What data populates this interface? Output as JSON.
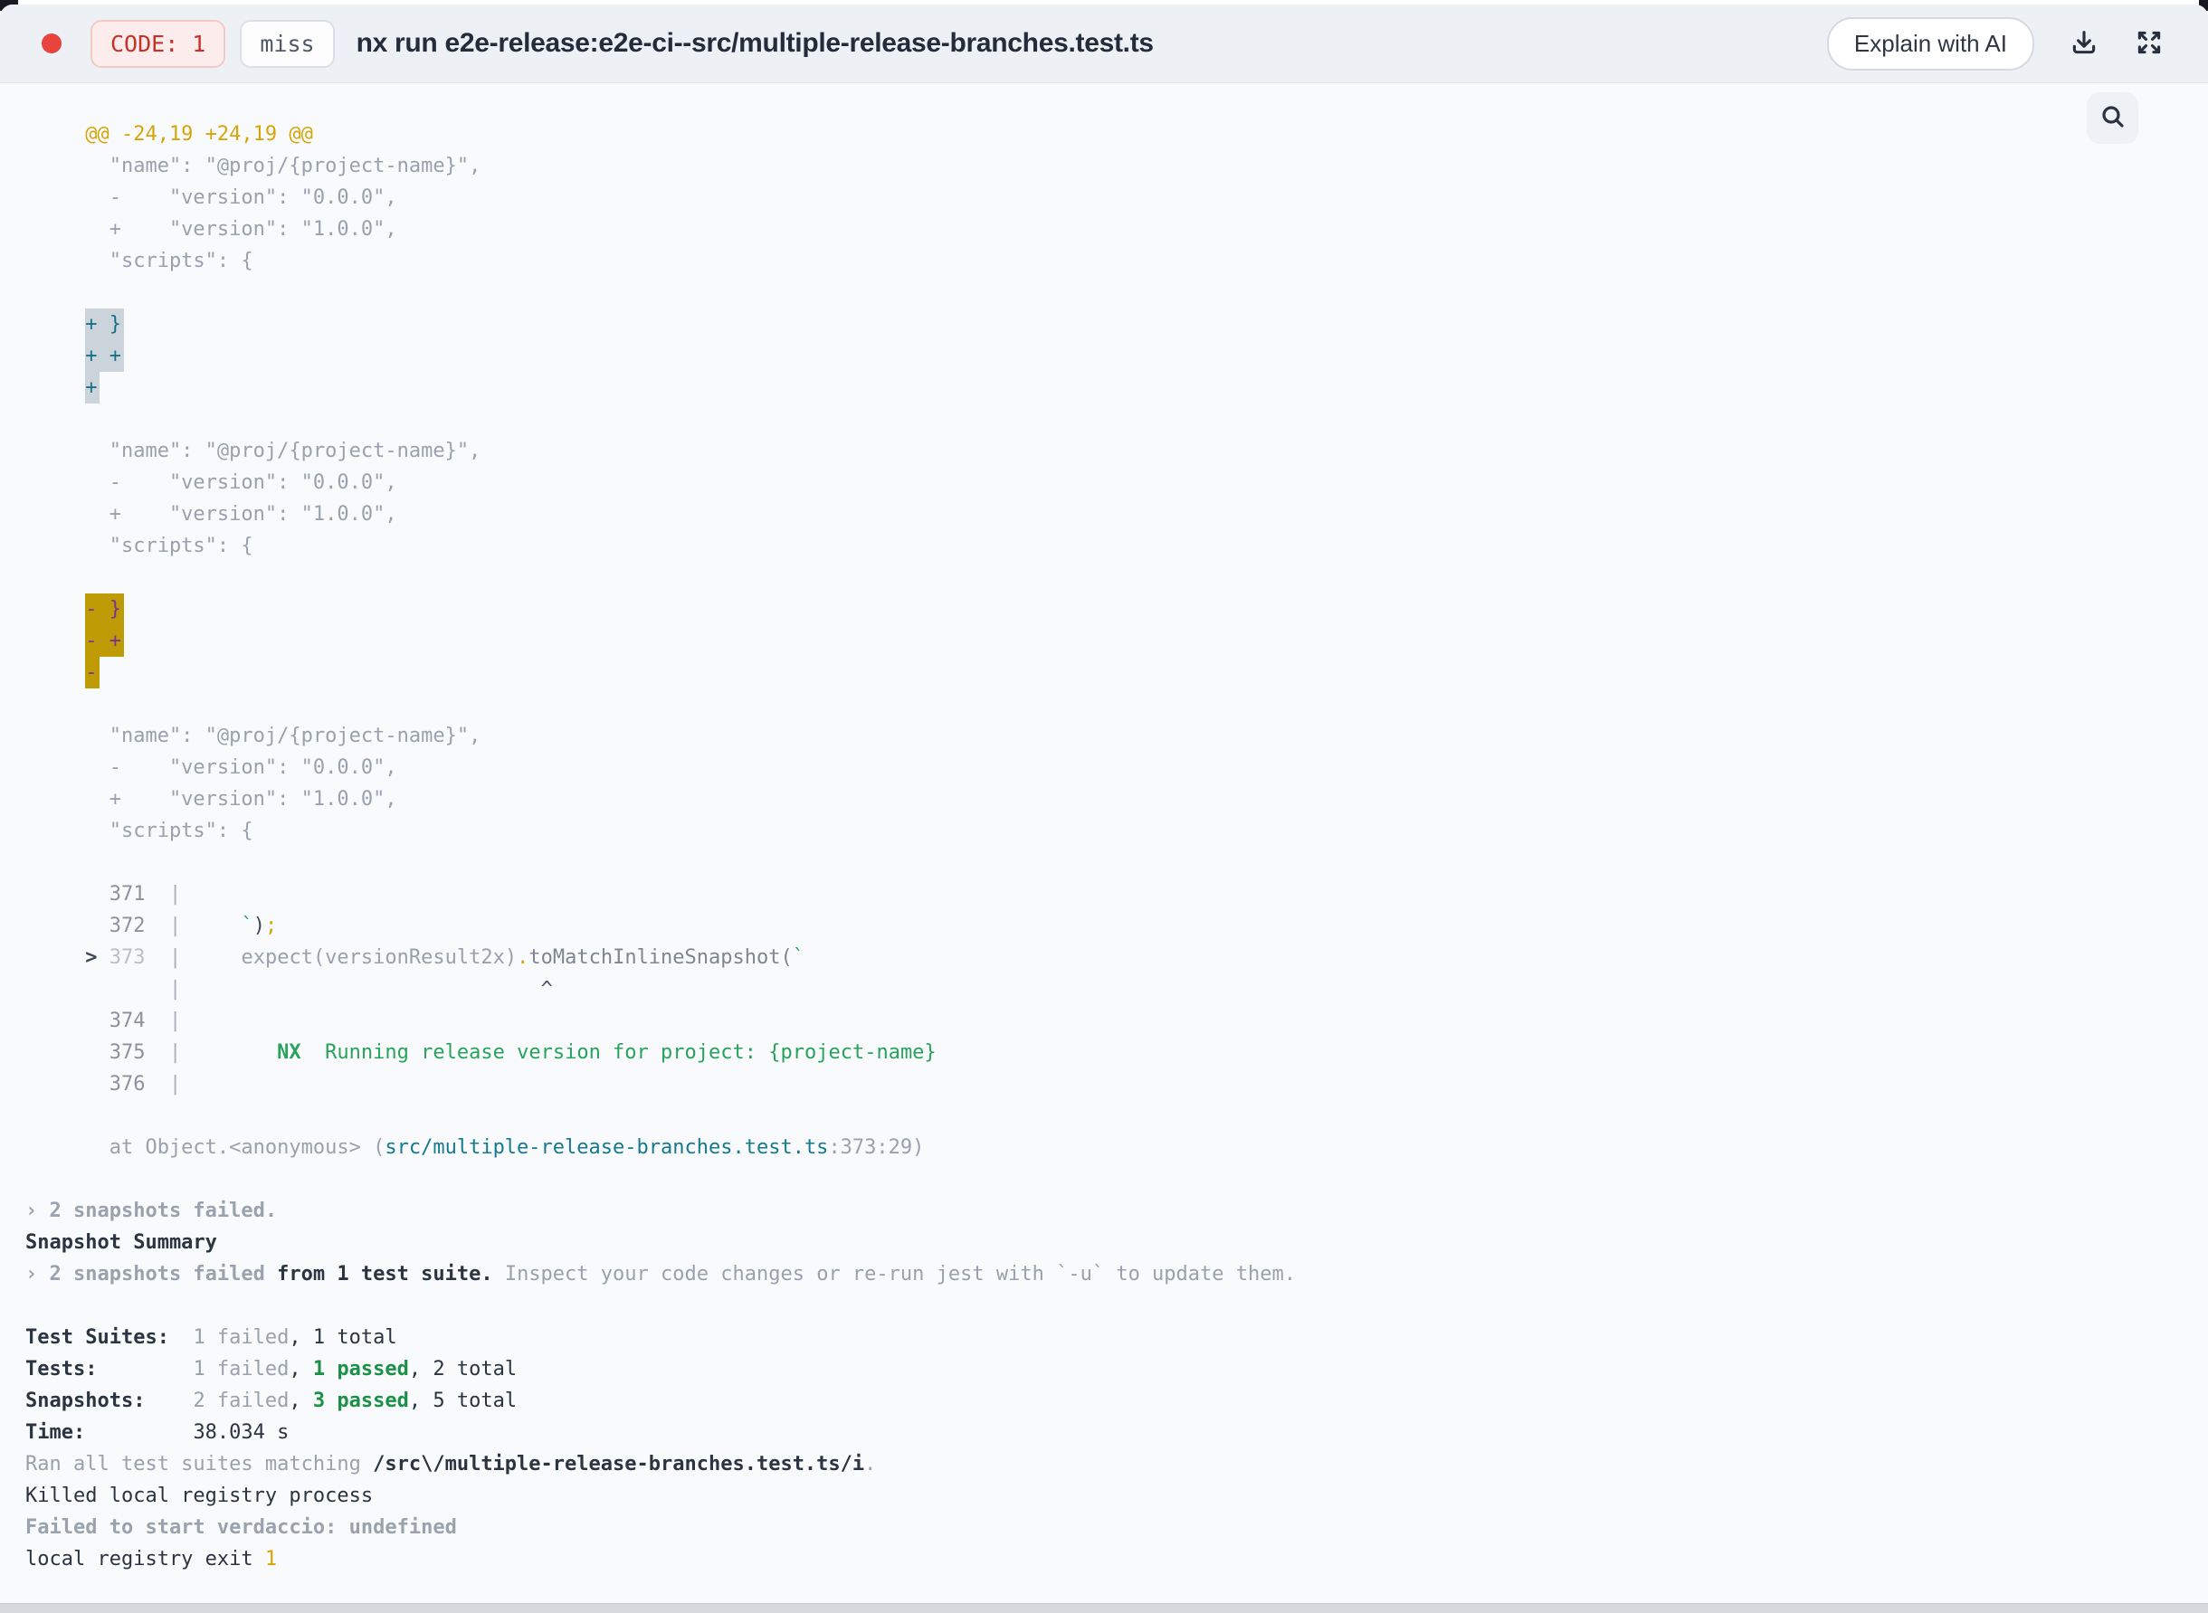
{
  "header": {
    "status_dot_icon": "red-status-dot",
    "code_badge": "CODE: 1",
    "miss_badge": "miss",
    "title": "nx run e2e-release:e2e-ci--src/multiple-release-branches.test.ts",
    "explain_button": "Explain with AI",
    "icons": [
      "download-icon",
      "expand-icon",
      "search-icon"
    ]
  },
  "colors": {
    "status_dot": "#e8433c",
    "code_badge_text": "#c43229",
    "amber": "#d7a50a",
    "add_highlight_bg": "#ccd4db",
    "add_highlight_text": "#167086",
    "del_highlight_bg": "#bf9c06",
    "del_highlight_text": "#7c3390",
    "green": "#27a35c",
    "passed_green": "#1d9048",
    "file_link_teal": "#15798f"
  },
  "terminal": {
    "lines": [
      {
        "s": [
          [
            "     @@ -24,19 +24,19 @@",
            "amber"
          ]
        ]
      },
      {
        "s": [
          [
            "       \"name\": \"@proj/{project-name}\",",
            "gray"
          ]
        ]
      },
      {
        "s": [
          [
            "       -    \"version\": \"0.0.0\",",
            "gray"
          ]
        ]
      },
      {
        "s": [
          [
            "       +    \"version\": \"1.0.0\",",
            "gray"
          ]
        ]
      },
      {
        "s": [
          [
            "       \"scripts\": {",
            "gray"
          ]
        ]
      },
      {
        "s": []
      },
      {
        "s": [
          [
            "     ",
            "gray"
          ],
          [
            "+ }",
            "hladd"
          ]
        ]
      },
      {
        "s": [
          [
            "     ",
            "gray"
          ],
          [
            "+ +",
            "hladd"
          ]
        ]
      },
      {
        "s": [
          [
            "     ",
            "gray"
          ],
          [
            "+",
            "hladd"
          ]
        ]
      },
      {
        "s": []
      },
      {
        "s": [
          [
            "       \"name\": \"@proj/{project-name}\",",
            "gray"
          ]
        ]
      },
      {
        "s": [
          [
            "       -    \"version\": \"0.0.0\",",
            "gray"
          ]
        ]
      },
      {
        "s": [
          [
            "       +    \"version\": \"1.0.0\",",
            "gray"
          ]
        ]
      },
      {
        "s": [
          [
            "       \"scripts\": {",
            "gray"
          ]
        ]
      },
      {
        "s": []
      },
      {
        "s": [
          [
            "     ",
            "gray"
          ],
          [
            "- }",
            "hldel"
          ]
        ]
      },
      {
        "s": [
          [
            "     ",
            "gray"
          ],
          [
            "- +",
            "hldel"
          ]
        ]
      },
      {
        "s": [
          [
            "     ",
            "gray"
          ],
          [
            "-",
            "hldel"
          ]
        ]
      },
      {
        "s": []
      },
      {
        "s": [
          [
            "       \"name\": \"@proj/{project-name}\",",
            "gray"
          ]
        ]
      },
      {
        "s": [
          [
            "       -    \"version\": \"0.0.0\",",
            "gray"
          ]
        ]
      },
      {
        "s": [
          [
            "       +    \"version\": \"1.0.0\",",
            "gray"
          ]
        ]
      },
      {
        "s": [
          [
            "       \"scripts\": {",
            "gray"
          ]
        ]
      },
      {
        "s": []
      },
      {
        "s": [
          [
            "       371",
            "num"
          ],
          [
            "  |",
            "bar"
          ]
        ]
      },
      {
        "s": [
          [
            "       372",
            "num"
          ],
          [
            "  |",
            "bar"
          ],
          [
            "     ",
            "gray"
          ],
          [
            "`",
            "green"
          ],
          [
            ")",
            "darkcode"
          ],
          [
            ";",
            "amber"
          ]
        ]
      },
      {
        "s": [
          [
            "     ",
            "gray"
          ],
          [
            ">",
            "arrow"
          ],
          [
            " ",
            "gray"
          ],
          [
            "373",
            "numlight"
          ],
          [
            "  |",
            "bar"
          ],
          [
            "     ",
            "gray"
          ],
          [
            "expect(versionResult2x)",
            "gray"
          ],
          [
            ".",
            "amber"
          ],
          [
            "toMatchInlineSnapshot(",
            "mid"
          ],
          [
            "`",
            "green"
          ]
        ]
      },
      {
        "s": [
          [
            "            ",
            "gray"
          ],
          [
            "|",
            "bar"
          ],
          [
            "                              ",
            "gray"
          ],
          [
            "^",
            "caret"
          ]
        ]
      },
      {
        "s": [
          [
            "       374",
            "num"
          ],
          [
            "  |",
            "bar"
          ]
        ]
      },
      {
        "s": [
          [
            "       375",
            "num"
          ],
          [
            "  |",
            "bar"
          ],
          [
            "        ",
            "gray"
          ],
          [
            "NX",
            "greenb"
          ],
          [
            "  ",
            "gray"
          ],
          [
            "Running release version for project: {project-name}",
            "green"
          ]
        ]
      },
      {
        "s": [
          [
            "       376",
            "num"
          ],
          [
            "  |",
            "bar"
          ]
        ]
      },
      {
        "s": []
      },
      {
        "s": [
          [
            "       at Object.<anonymous> (",
            "gray"
          ],
          [
            "src/multiple-release-branches.test.ts",
            "teal"
          ],
          [
            ":373:29)",
            "gray"
          ]
        ]
      },
      {
        "s": []
      },
      {
        "s": [
          [
            "› 2 snapshots failed.",
            "grayb"
          ]
        ]
      },
      {
        "s": [
          [
            "Snapshot Summary",
            "darkb"
          ]
        ]
      },
      {
        "s": [
          [
            "› 2 snapshots failed ",
            "grayb"
          ],
          [
            "from 1 test suite.",
            "darkb"
          ],
          [
            " Inspect your code changes or re-run jest with `-u` to update them.",
            "gray"
          ]
        ]
      },
      {
        "s": []
      },
      {
        "s": [
          [
            "Test Suites:  ",
            "darkb"
          ],
          [
            "1 failed",
            "gray"
          ],
          [
            ", ",
            "dark"
          ],
          [
            "1 total",
            "dark"
          ]
        ]
      },
      {
        "s": [
          [
            "Tests:        ",
            "darkb"
          ],
          [
            "1 failed",
            "gray"
          ],
          [
            ", ",
            "dark"
          ],
          [
            "1 passed",
            "greenb2"
          ],
          [
            ", ",
            "dark"
          ],
          [
            "2 total",
            "dark"
          ]
        ]
      },
      {
        "s": [
          [
            "Snapshots:    ",
            "darkb"
          ],
          [
            "2 failed",
            "gray"
          ],
          [
            ", ",
            "dark"
          ],
          [
            "3 passed",
            "greenb2"
          ],
          [
            ", ",
            "dark"
          ],
          [
            "5 total",
            "dark"
          ]
        ]
      },
      {
        "s": [
          [
            "Time:         ",
            "darkb"
          ],
          [
            "38.034 s",
            "dark"
          ]
        ]
      },
      {
        "s": [
          [
            "Ran all test suites matching ",
            "gray"
          ],
          [
            "/src\\/multiple-release-branches.test.ts/i",
            "darkb"
          ],
          [
            ".",
            "gray"
          ]
        ]
      },
      {
        "s": [
          [
            "Killed local registry process",
            "dark"
          ]
        ]
      },
      {
        "s": [
          [
            "Failed to start verdaccio: undefined",
            "grayb"
          ]
        ]
      },
      {
        "s": [
          [
            "local registry exit ",
            "dark"
          ],
          [
            "1",
            "amber"
          ]
        ]
      }
    ]
  }
}
